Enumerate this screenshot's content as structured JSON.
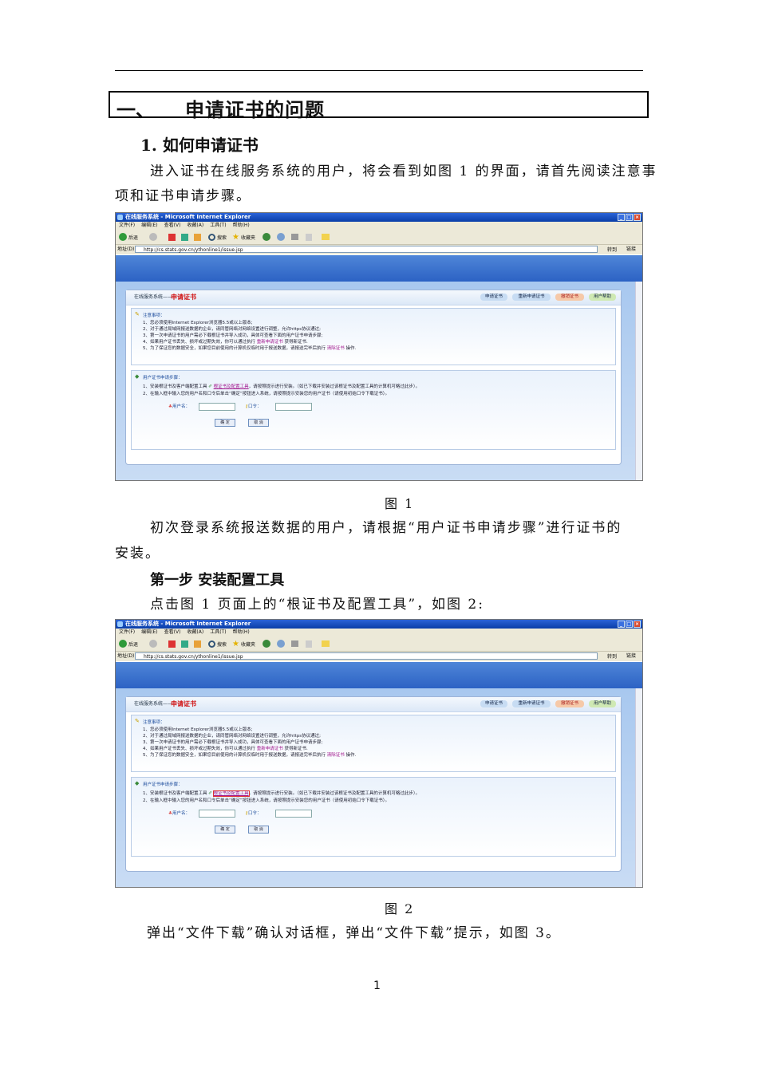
{
  "heading1": {
    "number": "一、",
    "title": "申请证书的问题"
  },
  "heading2": "1. 如何申请证书",
  "intro": {
    "line1": "进入证书在线服务系统的用户，将会看到如图 1 的界面，请首先阅读注意事",
    "line2": "项和证书申请步骤。"
  },
  "figure1": {
    "caption": "图 1"
  },
  "para2": {
    "line1": "初次登录系统报送数据的用户，请根据“用户证书申请步骤”进行证书的",
    "line2": "安装。"
  },
  "step1": "第一步 安装配置工具",
  "para3": "点击图 1 页面上的“根证书及配置工具”，如图 2:",
  "figure2": {
    "caption": "图 2"
  },
  "para4": "弹出“文件下载”确认对话框，弹出“文件下载”提示，如图 3。",
  "page_number": "1",
  "browser": {
    "window_title": "在线服务系统 - Microsoft Internet Explorer",
    "menu": [
      "文件(F)",
      "编辑(E)",
      "查看(V)",
      "收藏(A)",
      "工具(T)",
      "帮助(H)"
    ],
    "toolbar_back": "后退",
    "toolbar_search": "搜索",
    "toolbar_favorites": "收藏夹",
    "address_label": "地址(D)",
    "address": "http://cs.stats.gov.cn/ythonline1/issue.jsp",
    "go": "转到",
    "links": "链接",
    "system_name": "在线服务系统——",
    "page_title": "申请证书",
    "nav": [
      "申请证书",
      "重新申请证书",
      "撤销证书",
      "用户帮助"
    ],
    "notice_title": "注意事项：",
    "notices": [
      "1、您必须使用Internet Explorer浏览器5.5或以上版本;",
      "2、对于通过局域网报送数据的企业，请同管网络对网络设置进行调整，允许https协议通过;",
      "3、第一次申请证书的用户需必下载根证书并导入成功，具体可查看下面的用户证书申请步骤;",
      "4、如果用户证书丢失、损坏或过期失效，你可以通过执行",
      "5、为了保证您的数据安全，如果您目前使用的计算机仅临时用于报送数据，请报送完毕后执行"
    ],
    "notice4_link": "重新申请证书",
    "notice4_tail": "获得新证书.",
    "notice5_link": "清除证书",
    "notice5_tail": "操作.",
    "steps_title": "用户证书申请步骤：",
    "step1_pre": "1、安装根证书及客户端配置工具",
    "step1_link": "根证书及配置工具",
    "step1_post": "，请按照提示进行安装。（如已下载并安装过该根证书及配置工具的计算机可略过此步）。",
    "step2": "2、在输入框中输入您的用户名和口令后单击“确定”按钮进入系统，请按照提示安装您的用户证书（请使用初始口令下载证书）。",
    "username_label": "用户名：",
    "password_label": "口令：",
    "ok": "确 定",
    "cancel": "取 消"
  }
}
